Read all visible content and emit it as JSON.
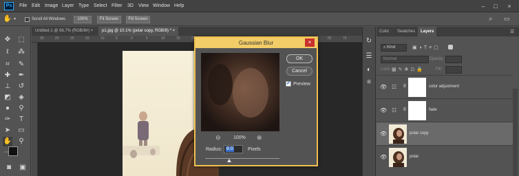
{
  "menubar": {
    "items": [
      "File",
      "Edit",
      "Image",
      "Layer",
      "Type",
      "Select",
      "Filter",
      "3D",
      "View",
      "Window",
      "Help"
    ],
    "window_controls": [
      "–",
      "□",
      "×"
    ]
  },
  "options": {
    "scroll_all_windows": "Scroll All Windows",
    "zoom": "100%",
    "fit_screen": "Fit Screen",
    "fill_screen": "Fill Screen"
  },
  "tabs": [
    {
      "label": "Untitled-1 @ 66.7% (RGB/8#) ×",
      "active": false
    },
    {
      "label": "p1.jpg @ 10.1% (polar copy, RGB/8) * ×",
      "active": true
    }
  ],
  "ruler": {
    "ticks": [
      "30",
      "25",
      "20",
      "15",
      "10",
      "5",
      "0",
      "5",
      "10",
      "15",
      "20",
      "25",
      "30",
      "35",
      "40",
      "45",
      "50",
      "55",
      "60",
      "65",
      "70",
      "75",
      "80"
    ]
  },
  "dialog": {
    "title": "Gaussian Blur",
    "close": "×",
    "ok": "OK",
    "cancel": "Cancel",
    "preview_label": "Preview",
    "preview_checked": true,
    "zoom_out": "⊖",
    "zoom_level": "100%",
    "zoom_in": "⊕",
    "radius_label": "Radius:",
    "radius_value": "8.0",
    "radius_unit": "Pixels"
  },
  "panels": {
    "tabs": [
      {
        "label": "Color",
        "active": false
      },
      {
        "label": "Swatches",
        "active": false
      },
      {
        "label": "Layers",
        "active": true
      }
    ],
    "kind": "⌕ Kind",
    "blend_mode": "Normal",
    "opacity_label": "Opacity:",
    "lock_label": "Lock:",
    "fill_label": "Fill:",
    "layers": [
      {
        "name": "color adjustment",
        "type": "adjustment",
        "selected": false
      },
      {
        "name": "fade",
        "type": "adjustment",
        "selected": false
      },
      {
        "name": "polar copy",
        "type": "photo",
        "selected": true
      },
      {
        "name": "polar",
        "type": "photo",
        "selected": false
      }
    ]
  },
  "colors": {
    "dialog_border": "#f0c04f",
    "dialog_title": "#f3cd68",
    "close_red": "#c8312b",
    "radius_highlight": "#3a6fc4"
  }
}
